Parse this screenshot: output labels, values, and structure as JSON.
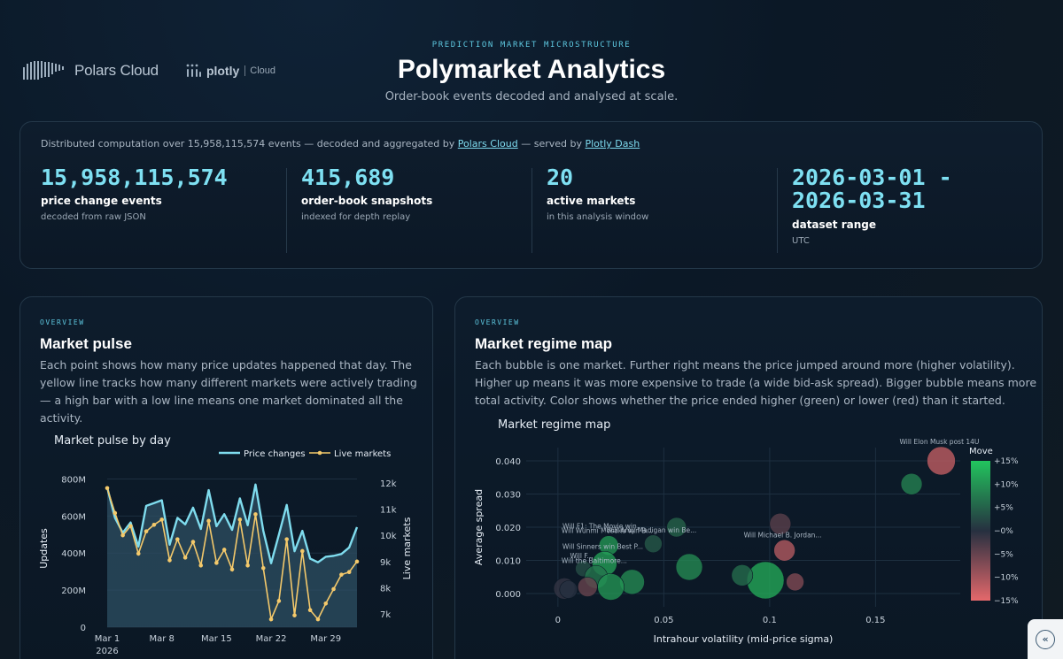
{
  "brand": {
    "polars_name": "Polars Cloud",
    "plotly_name": "plotly",
    "plotly_sub": "Cloud"
  },
  "header": {
    "eyebrow": "PREDICTION MARKET MICROSTRUCTURE",
    "title": "Polymarket Analytics",
    "subtitle": "Order-book events decoded and analysed at scale."
  },
  "stats": {
    "intro_prefix": "Distributed computation over 15,958,115,574 events — decoded and aggregated by ",
    "intro_link1": "Polars Cloud",
    "intro_mid": " — served by ",
    "intro_link2": "Plotly Dash",
    "items": [
      {
        "value": "15,958,115,574",
        "label": "price change events",
        "note": "decoded from raw JSON"
      },
      {
        "value": "415,689",
        "label": "order-book snapshots",
        "note": "indexed for depth replay"
      },
      {
        "value": "20",
        "label": "active markets",
        "note": "in this analysis window"
      },
      {
        "value_line1": "2026-03-01 -",
        "value_line2": "2026-03-31",
        "label": "dataset range",
        "note": "UTC"
      }
    ]
  },
  "pulse_card": {
    "eyebrow": "OVERVIEW",
    "title": "Market pulse",
    "desc_lines": [
      "Each point shows how many price updates happened that day. The",
      "yellow line tracks how many different markets were actively trading",
      "— a high bar with a low line means one market dominated all the",
      "activity."
    ]
  },
  "regime_card": {
    "eyebrow": "OVERVIEW",
    "title": "Market regime map",
    "desc_lines": [
      "Each bubble is one market. Further right means the price jumped around more (higher volatility).",
      "Higher up means it was more expensive to trade (a wide bid-ask spread). Bigger bubble means more",
      "total activity. Color shows whether the price ended higher (green) or lower (red) than it started."
    ]
  },
  "colors": {
    "accent_cyan": "#7ee0f2",
    "line_cyan": "#7fdcee",
    "line_yellow": "#f4c96b",
    "green": "#22c55e",
    "red": "#e5686b"
  },
  "chart_data": [
    {
      "type": "area",
      "title": "Market pulse by day",
      "ylabel": "Updates",
      "y2label": "Live markets",
      "ylim": [
        0,
        850000000
      ],
      "y2lim": [
        6500,
        12500
      ],
      "yticks": [
        "0",
        "200M",
        "400M",
        "600M",
        "800M"
      ],
      "y2ticks": [
        "7k",
        "8k",
        "9k",
        "10k",
        "11k",
        "12k"
      ],
      "xticks": [
        "Mar 1",
        "Mar 8",
        "Mar 15",
        "Mar 22",
        "Mar 29"
      ],
      "xtick_sub": "2026",
      "legend": [
        "Price changes",
        "Live markets"
      ],
      "x": [
        "2026-03-01",
        "2026-03-02",
        "2026-03-03",
        "2026-03-04",
        "2026-03-05",
        "2026-03-06",
        "2026-03-07",
        "2026-03-08",
        "2026-03-09",
        "2026-03-10",
        "2026-03-11",
        "2026-03-12",
        "2026-03-13",
        "2026-03-14",
        "2026-03-15",
        "2026-03-16",
        "2026-03-17",
        "2026-03-18",
        "2026-03-19",
        "2026-03-20",
        "2026-03-21",
        "2026-03-22",
        "2026-03-23",
        "2026-03-24",
        "2026-03-25",
        "2026-03-26",
        "2026-03-27",
        "2026-03-28",
        "2026-03-29",
        "2026-03-30",
        "2026-03-31"
      ],
      "series": [
        {
          "name": "Price changes",
          "values": [
            755000000,
            590000000,
            510000000,
            565000000,
            435000000,
            655000000,
            670000000,
            685000000,
            445000000,
            590000000,
            555000000,
            645000000,
            530000000,
            740000000,
            545000000,
            610000000,
            525000000,
            695000000,
            550000000,
            770000000,
            520000000,
            345000000,
            500000000,
            660000000,
            410000000,
            520000000,
            370000000,
            350000000,
            380000000,
            385000000,
            395000000,
            430000000,
            540000000
          ]
        },
        {
          "name": "Live markets",
          "values": [
            11800,
            10850,
            10000,
            10350,
            9300,
            10150,
            10400,
            10600,
            9050,
            9850,
            9150,
            9750,
            8850,
            10550,
            8950,
            9450,
            8700,
            10600,
            8850,
            10800,
            8750,
            6800,
            7500,
            9850,
            6950,
            9400,
            7150,
            6800,
            7400,
            7950,
            8500,
            8600,
            9000
          ]
        }
      ]
    },
    {
      "type": "scatter",
      "title": "Market regime map",
      "xlabel": "Intrahour volatility (mid-price sigma)",
      "ylabel": "Average spread",
      "xlim": [
        -0.015,
        0.19
      ],
      "ylim": [
        -0.004,
        0.044
      ],
      "xticks": [
        "0",
        "0.05",
        "0.1",
        "0.15"
      ],
      "yticks": [
        "0.000",
        "0.010",
        "0.020",
        "0.030",
        "0.040"
      ],
      "colorbar_title": "Move",
      "colorbar_ticks": [
        "+15%",
        "+10%",
        "+5%",
        "−0%",
        "−5%",
        "−10%",
        "−15%"
      ],
      "points": [
        {
          "x": 0.181,
          "y": 0.04,
          "size": 16,
          "move": -0.12,
          "label": "Will Elon Musk post 14U"
        },
        {
          "x": 0.167,
          "y": 0.033,
          "size": 12,
          "move": 0.08,
          "label": ""
        },
        {
          "x": 0.056,
          "y": 0.02,
          "size": 11,
          "move": 0.05,
          "label": ""
        },
        {
          "x": 0.105,
          "y": 0.021,
          "size": 12,
          "move": -0.04,
          "label": ""
        },
        {
          "x": 0.045,
          "y": 0.015,
          "size": 10,
          "move": 0.04,
          "label": "Will Amy Madigan win Be..."
        },
        {
          "x": 0.107,
          "y": 0.013,
          "size": 12,
          "move": -0.11,
          "label": "Will Michael B. Jordan..."
        },
        {
          "x": 0.024,
          "y": 0.0145,
          "size": 11,
          "move": 0.1,
          "label": "Will Wunmi Mosaku win B..."
        },
        {
          "x": 0.022,
          "y": 0.0185,
          "size": 1,
          "move": 0.0,
          "label": "Will F1: The Movie win..."
        },
        {
          "x": 0.062,
          "y": 0.008,
          "size": 15,
          "move": 0.09,
          "label": ""
        },
        {
          "x": 0.098,
          "y": 0.004,
          "size": 21,
          "move": 0.12,
          "label": ""
        },
        {
          "x": 0.087,
          "y": 0.0055,
          "size": 12,
          "move": 0.06,
          "label": ""
        },
        {
          "x": 0.112,
          "y": 0.0035,
          "size": 10,
          "move": -0.07,
          "label": ""
        },
        {
          "x": 0.022,
          "y": 0.009,
          "size": 14,
          "move": 0.11,
          "label": "Will Sinners win Best P..."
        },
        {
          "x": 0.012,
          "y": 0.0075,
          "size": 9,
          "move": 0.03,
          "label": "Will F..."
        },
        {
          "x": 0.018,
          "y": 0.005,
          "size": 13,
          "move": 0.07,
          "label": "Will the Baltimore..."
        },
        {
          "x": 0.035,
          "y": 0.0035,
          "size": 14,
          "move": 0.09,
          "label": ""
        },
        {
          "x": 0.025,
          "y": 0.002,
          "size": 15,
          "move": 0.1,
          "label": ""
        },
        {
          "x": 0.014,
          "y": 0.002,
          "size": 11,
          "move": -0.05,
          "label": ""
        },
        {
          "x": 0.003,
          "y": 0.0015,
          "size": 12,
          "move": -0.01,
          "label": ""
        },
        {
          "x": 0.005,
          "y": 0.0012,
          "size": 10,
          "move": 0.0,
          "label": ""
        }
      ]
    }
  ]
}
